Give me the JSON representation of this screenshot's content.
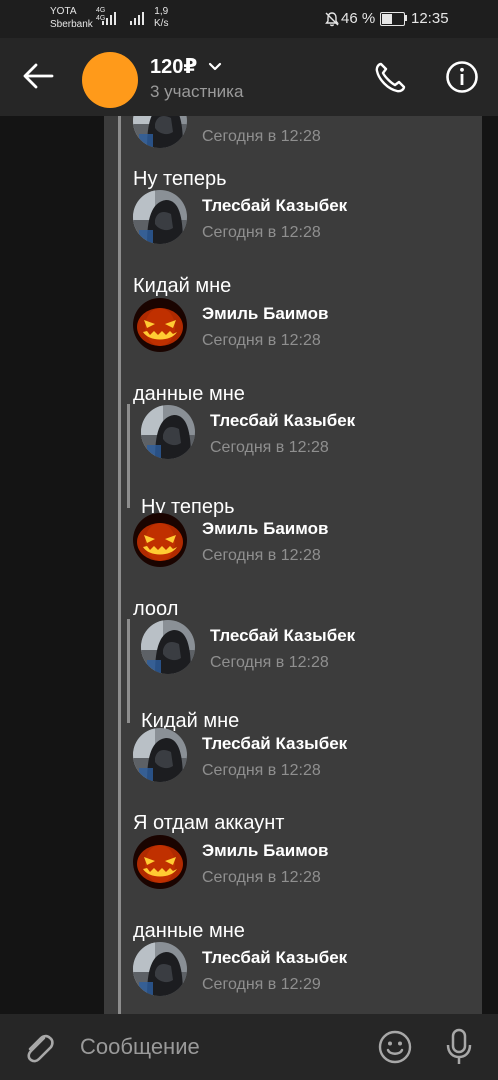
{
  "status_bar": {
    "carrier1": "YOTA",
    "carrier2": "Sberbank",
    "net_top": "4G",
    "net_bottom": "4G",
    "speed_value": "1,9",
    "speed_unit": "K/s",
    "battery_text": "46 %",
    "battery_level": 0.46,
    "time": "12:35"
  },
  "header": {
    "title": "120₽",
    "subtitle": "3 участника",
    "avatar_color": "#ff9a1a"
  },
  "messages": [
    {
      "kind": "partial",
      "time": "Сегодня в 12:28",
      "avatar": "hood"
    },
    {
      "kind": "text",
      "text": "Ну теперь"
    },
    {
      "kind": "header",
      "name": "Тлесбай Казыбек",
      "time": "Сегодня в 12:28",
      "avatar": "hood"
    },
    {
      "kind": "text",
      "text": "Кидай мне"
    },
    {
      "kind": "header",
      "name": "Эмиль Баимов",
      "time": "Сегодня в 12:28",
      "avatar": "pumpkin"
    },
    {
      "kind": "text",
      "text": "данные мне"
    },
    {
      "kind": "nested_header",
      "name": "Тлесбай Казыбек",
      "time": "Сегодня в 12:28",
      "avatar": "hood"
    },
    {
      "kind": "nested_text",
      "text": "Ну теперь"
    },
    {
      "kind": "header",
      "name": "Эмиль Баимов",
      "time": "Сегодня в 12:28",
      "avatar": "pumpkin"
    },
    {
      "kind": "text",
      "text": "лоол"
    },
    {
      "kind": "nested_header",
      "name": "Тлесбай Казыбек",
      "time": "Сегодня в 12:28",
      "avatar": "hood"
    },
    {
      "kind": "nested_text",
      "text": "Кидай мне"
    },
    {
      "kind": "header",
      "name": "Тлесбай Казыбек",
      "time": "Сегодня в 12:28",
      "avatar": "hood"
    },
    {
      "kind": "text",
      "text": "Я отдам аккаунт"
    },
    {
      "kind": "header",
      "name": "Эмиль Баимов",
      "time": "Сегодня в 12:28",
      "avatar": "pumpkin"
    },
    {
      "kind": "text",
      "text": "данные мне"
    },
    {
      "kind": "header",
      "name": "Тлесбай Казыбек",
      "time": "Сегодня в 12:29",
      "avatar": "hood"
    }
  ],
  "input_bar": {
    "placeholder": "Сообщение"
  },
  "colors": {
    "accent": "#ff9a1a",
    "background": "#141414",
    "forward_panel": "#3c3c3c",
    "forward_line": "#8d8d8d"
  }
}
